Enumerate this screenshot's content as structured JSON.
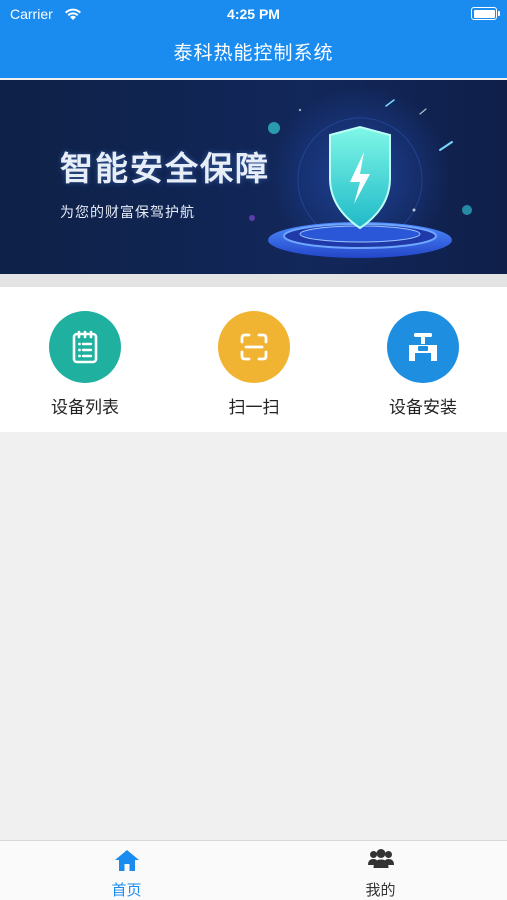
{
  "status_bar": {
    "carrier": "Carrier",
    "time": "4:25 PM"
  },
  "nav": {
    "title": "泰科热能控制系统"
  },
  "banner": {
    "headline": "智能安全保障",
    "subtitle": "为您的财富保驾护航"
  },
  "quick_actions": [
    {
      "label": "设备列表",
      "icon": "clipboard-list-icon",
      "color": "#1fb0a0"
    },
    {
      "label": "扫一扫",
      "icon": "scan-icon",
      "color": "#f1b432"
    },
    {
      "label": "设备安装",
      "icon": "valve-icon",
      "color": "#1e8fe0"
    }
  ],
  "tabs": [
    {
      "label": "首页",
      "icon": "home-icon",
      "active": true
    },
    {
      "label": "我的",
      "icon": "users-icon",
      "active": false
    }
  ],
  "colors": {
    "primary": "#1a8cf0",
    "active_tab": "#1a8cf0",
    "inactive_tab": "#333333",
    "background": "#f0f0f0"
  }
}
